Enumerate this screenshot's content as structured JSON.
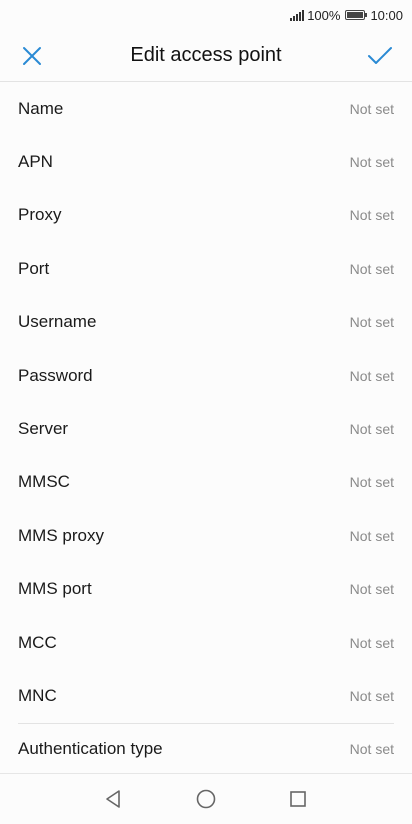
{
  "status_bar": {
    "battery_percent": "100%",
    "time": "10:00"
  },
  "app_bar": {
    "title": "Edit access point",
    "close_icon": "close-icon",
    "confirm_icon": "check-icon",
    "accent_color": "#2a8ad4"
  },
  "fields": [
    {
      "label": "Name",
      "value": "Not set"
    },
    {
      "label": "APN",
      "value": "Not set"
    },
    {
      "label": "Proxy",
      "value": "Not set"
    },
    {
      "label": "Port",
      "value": "Not set"
    },
    {
      "label": "Username",
      "value": "Not set"
    },
    {
      "label": "Password",
      "value": "Not set"
    },
    {
      "label": "Server",
      "value": "Not set"
    },
    {
      "label": "MMSC",
      "value": "Not set"
    },
    {
      "label": "MMS proxy",
      "value": "Not set"
    },
    {
      "label": "MMS port",
      "value": "Not set"
    },
    {
      "label": "MCC",
      "value": "Not set"
    },
    {
      "label": "MNC",
      "value": "Not set"
    },
    {
      "label": "Authentication type",
      "value": "Not set"
    }
  ],
  "nav_bar": {
    "back_icon": "back-triangle-icon",
    "home_icon": "home-circle-icon",
    "recents_icon": "recents-square-icon"
  }
}
